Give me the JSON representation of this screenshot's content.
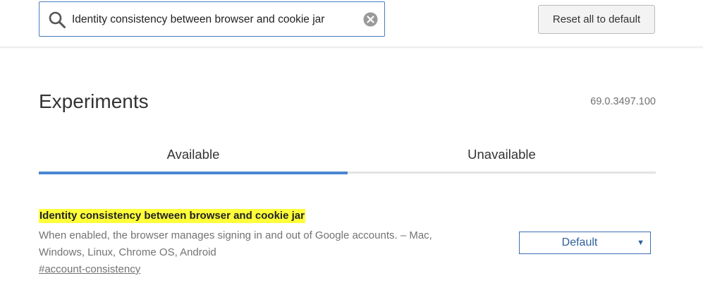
{
  "header": {
    "search": {
      "value": "Identity consistency between browser and cookie jar",
      "icon": "search-icon",
      "clear_icon": "clear-icon"
    },
    "reset_label": "Reset all to default"
  },
  "page": {
    "title": "Experiments",
    "version": "69.0.3497.100"
  },
  "tabs": [
    {
      "label": "Available",
      "selected": true
    },
    {
      "label": "Unavailable",
      "selected": false
    }
  ],
  "experiments": [
    {
      "title": "Identity consistency between browser and cookie jar",
      "description": "When enabled, the browser manages signing in and out of Google accounts. – Mac, Windows, Linux, Chrome OS, Android",
      "link": "#account-consistency",
      "select_value": "Default"
    }
  ],
  "colors": {
    "accent": "#4a86d0",
    "search_border": "#4a7bc2",
    "highlight": "#ffff3a",
    "select_text": "#2f5f9c",
    "muted_text": "#737373"
  }
}
